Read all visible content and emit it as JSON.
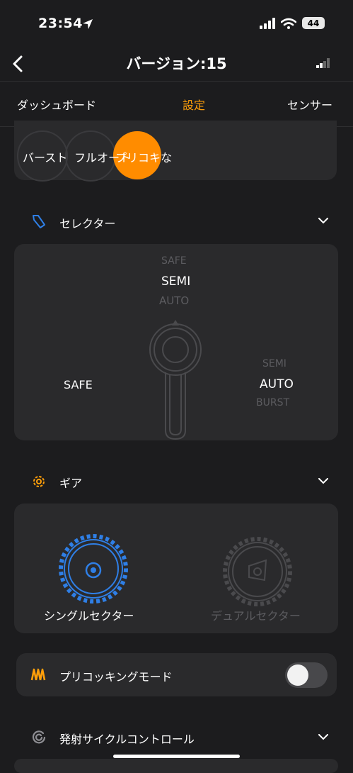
{
  "status": {
    "time": "23:54",
    "battery": "44"
  },
  "nav": {
    "title": "バージョン:15"
  },
  "tabs": [
    {
      "label": "ダッシュボード",
      "active": false
    },
    {
      "label": "設定",
      "active": true
    },
    {
      "label": "センサー",
      "active": false
    }
  ],
  "modes": {
    "text": "バースト",
    "text2": "フルオート",
    "text3": "プリコキな"
  },
  "selector": {
    "title": "セレクター",
    "left": "SAFE",
    "top": [
      "SAFE",
      "SEMI",
      "AUTO"
    ],
    "right": [
      "SEMI",
      "AUTO",
      "BURST"
    ]
  },
  "gear": {
    "title": "ギア",
    "single": "シングルセクター",
    "dual": "デュアルセクター"
  },
  "precock": {
    "label": "プリコッキングモード",
    "enabled": false
  },
  "cycle": {
    "title": "発射サイクルコントロール"
  },
  "colors": {
    "accent": "#ff9f0a",
    "blue": "#2f7fe6",
    "card": "#2a2a2c",
    "background": "#1c1c1e"
  },
  "icons": {
    "back": "chevron-left-icon",
    "signal_nav": "signal-bars-icon",
    "selector": "selector-switch-icon",
    "gear": "gear-icon",
    "precock": "precock-icon",
    "cycle": "cycle-control-icon"
  }
}
